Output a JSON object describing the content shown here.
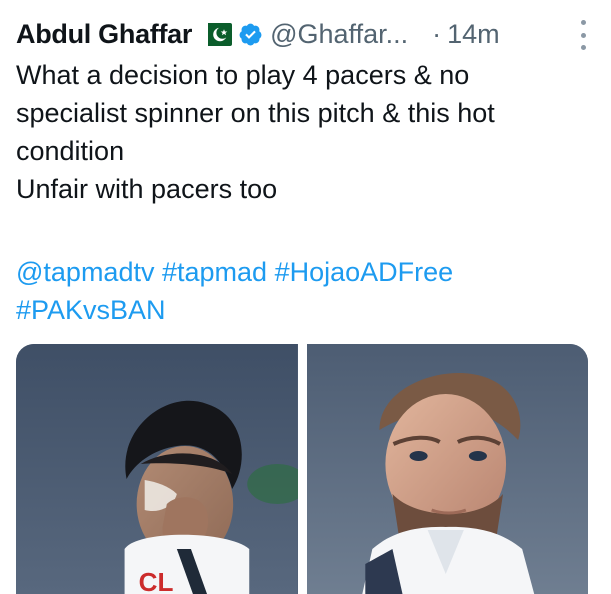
{
  "tweet": {
    "display_name": "Abdul Ghaffar",
    "flag_icon": "pakistan-flag-icon",
    "verified_icon": "verified-badge-icon",
    "handle": "@Ghaffar...",
    "separator": "·",
    "time": "14m",
    "more_icon": "more-vertical-icon",
    "text_lines": [
      "What a decision to play 4 pacers & no",
      "specialist spinner on this pitch & this hot",
      "condition",
      "Unfair with pacers too"
    ],
    "tags": [
      "@tapmadtv",
      "#tapmad",
      "#HojaoADFree",
      "#PAKvsBAN"
    ],
    "link_color": "#1d9bf0"
  },
  "media": {
    "left_logo_text": "CL"
  }
}
